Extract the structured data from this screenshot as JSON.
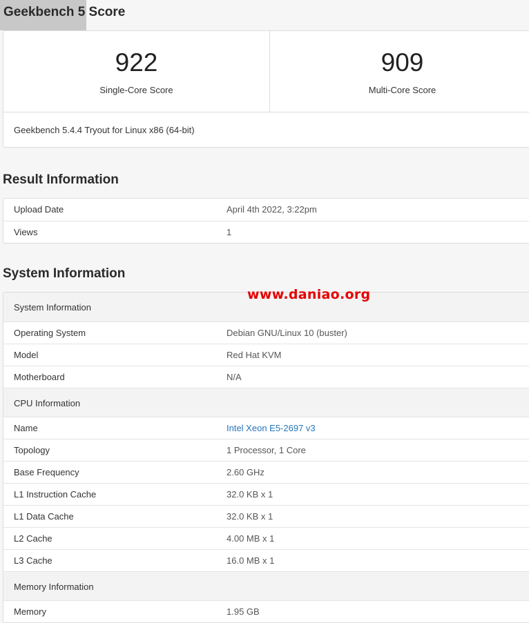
{
  "page": {
    "title": "Geekbench 5 Score"
  },
  "scores": {
    "single": {
      "value": "922",
      "label": "Single-Core Score"
    },
    "multi": {
      "value": "909",
      "label": "Multi-Core Score"
    },
    "version": "Geekbench 5.4.4 Tryout for Linux x86 (64-bit)"
  },
  "result_info": {
    "heading": "Result Information",
    "rows": [
      {
        "key": "Upload Date",
        "value": "April 4th 2022, 3:22pm"
      },
      {
        "key": "Views",
        "value": "1"
      }
    ]
  },
  "system_info": {
    "heading": "System Information",
    "groups": [
      {
        "label": "System Information",
        "rows": [
          {
            "key": "Operating System",
            "value": "Debian GNU/Linux 10 (buster)"
          },
          {
            "key": "Model",
            "value": "Red Hat KVM"
          },
          {
            "key": "Motherboard",
            "value": "N/A"
          }
        ]
      },
      {
        "label": "CPU Information",
        "rows": [
          {
            "key": "Name",
            "value": "Intel Xeon E5-2697 v3"
          },
          {
            "key": "Topology",
            "value": "1 Processor, 1 Core"
          },
          {
            "key": "Base Frequency",
            "value": "2.60 GHz"
          },
          {
            "key": "L1 Instruction Cache",
            "value": "32.0 KB x 1"
          },
          {
            "key": "L1 Data Cache",
            "value": "32.0 KB x 1"
          },
          {
            "key": "L2 Cache",
            "value": "4.00 MB x 1"
          },
          {
            "key": "L3 Cache",
            "value": "16.0 MB x 1"
          }
        ]
      },
      {
        "label": "Memory Information",
        "rows": [
          {
            "key": "Memory",
            "value": "1.95 GB"
          }
        ]
      }
    ]
  },
  "watermark": "www.daniao.org",
  "colors": {
    "link": "#2676b9",
    "watermark": "#e60000",
    "group_bg": "#f3f3f3"
  }
}
